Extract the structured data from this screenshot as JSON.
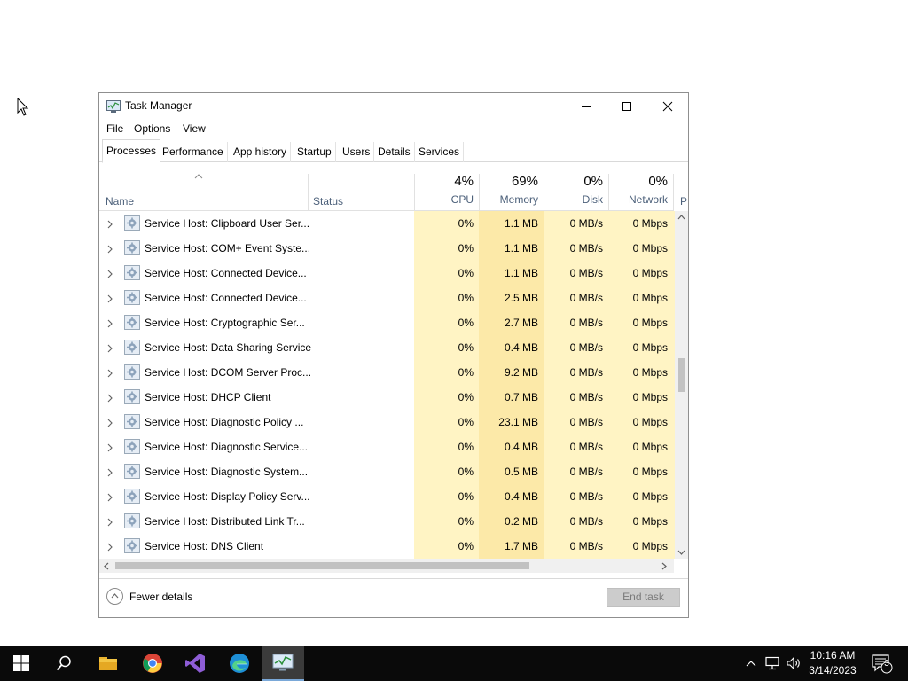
{
  "window": {
    "title": "Task Manager",
    "menu": [
      "File",
      "Options",
      "View"
    ],
    "tabs": [
      "Processes",
      "Performance",
      "App history",
      "Startup",
      "Users",
      "Details",
      "Services"
    ]
  },
  "columns": {
    "name": "Name",
    "status": "Status",
    "cpu": {
      "pct": "4%",
      "label": "CPU"
    },
    "memory": {
      "pct": "69%",
      "label": "Memory"
    },
    "disk": {
      "pct": "0%",
      "label": "Disk"
    },
    "network": {
      "pct": "0%",
      "label": "Network"
    },
    "power_partial": "P"
  },
  "processes": [
    {
      "name": "Service Host: Clipboard User Ser...",
      "cpu": "0%",
      "memory": "1.1 MB",
      "disk": "0 MB/s",
      "network": "0 Mbps"
    },
    {
      "name": "Service Host: COM+ Event Syste...",
      "cpu": "0%",
      "memory": "1.1 MB",
      "disk": "0 MB/s",
      "network": "0 Mbps"
    },
    {
      "name": "Service Host: Connected Device...",
      "cpu": "0%",
      "memory": "1.1 MB",
      "disk": "0 MB/s",
      "network": "0 Mbps"
    },
    {
      "name": "Service Host: Connected Device...",
      "cpu": "0%",
      "memory": "2.5 MB",
      "disk": "0 MB/s",
      "network": "0 Mbps"
    },
    {
      "name": "Service Host: Cryptographic Ser...",
      "cpu": "0%",
      "memory": "2.7 MB",
      "disk": "0 MB/s",
      "network": "0 Mbps"
    },
    {
      "name": "Service Host: Data Sharing Service",
      "cpu": "0%",
      "memory": "0.4 MB",
      "disk": "0 MB/s",
      "network": "0 Mbps"
    },
    {
      "name": "Service Host: DCOM Server Proc...",
      "cpu": "0%",
      "memory": "9.2 MB",
      "disk": "0 MB/s",
      "network": "0 Mbps"
    },
    {
      "name": "Service Host: DHCP Client",
      "cpu": "0%",
      "memory": "0.7 MB",
      "disk": "0 MB/s",
      "network": "0 Mbps"
    },
    {
      "name": "Service Host: Diagnostic Policy ...",
      "cpu": "0%",
      "memory": "23.1 MB",
      "disk": "0 MB/s",
      "network": "0 Mbps"
    },
    {
      "name": "Service Host: Diagnostic Service...",
      "cpu": "0%",
      "memory": "0.4 MB",
      "disk": "0 MB/s",
      "network": "0 Mbps"
    },
    {
      "name": "Service Host: Diagnostic System...",
      "cpu": "0%",
      "memory": "0.5 MB",
      "disk": "0 MB/s",
      "network": "0 Mbps"
    },
    {
      "name": "Service Host: Display Policy Serv...",
      "cpu": "0%",
      "memory": "0.4 MB",
      "disk": "0 MB/s",
      "network": "0 Mbps"
    },
    {
      "name": "Service Host: Distributed Link Tr...",
      "cpu": "0%",
      "memory": "0.2 MB",
      "disk": "0 MB/s",
      "network": "0 Mbps"
    },
    {
      "name": "Service Host: DNS Client",
      "cpu": "0%",
      "memory": "1.7 MB",
      "disk": "0 MB/s",
      "network": "0 Mbps"
    }
  ],
  "footer": {
    "fewer_details": "Fewer details",
    "end_task": "End task"
  },
  "taskbar": {
    "apps": [
      "start-icon",
      "search-icon",
      "file-explorer-icon",
      "chrome-icon",
      "visual-studio-icon",
      "edge-icon",
      "task-manager-icon"
    ],
    "time": "10:16 AM",
    "date": "3/14/2023",
    "notification_count": "3"
  },
  "colors": {
    "cpu_band": "#fff4c4",
    "memory_band": "#fce9a8",
    "disk_band": "#fff4c4",
    "network_band": "#fff4c4",
    "header_text": "#4c607a"
  }
}
